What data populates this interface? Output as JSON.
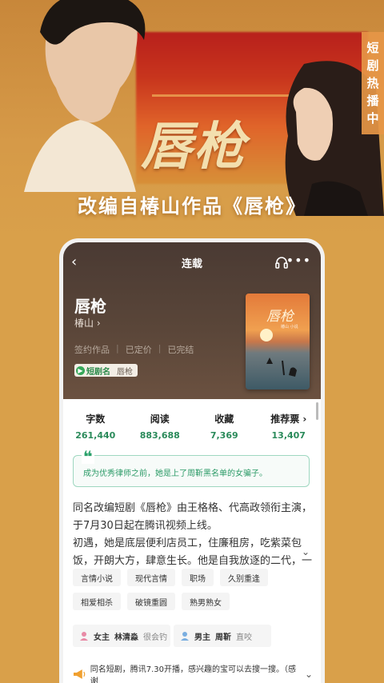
{
  "banner": {
    "poster_title": "唇枪",
    "caption": "改编自椿山作品《唇枪》",
    "side_tag": [
      "短",
      "剧",
      "热",
      "播",
      "中"
    ]
  },
  "topbar": {
    "title": "连载"
  },
  "book": {
    "title": "唇枪",
    "author": "椿山 ›",
    "meta": [
      "签约作品",
      "已定价",
      "已完结"
    ],
    "drama_badge": {
      "label": "短剧名",
      "name": "唇枪"
    },
    "cover_title": "唇枪",
    "cover_sub": "椿山 小说"
  },
  "stats": [
    {
      "label": "字数",
      "value": "261,440"
    },
    {
      "label": "阅读",
      "value": "883,688"
    },
    {
      "label": "收藏",
      "value": "7,369"
    },
    {
      "label": "推荐票 ›",
      "value": "13,407"
    }
  ],
  "quote": {
    "mark": "❝",
    "text": "成为优秀律师之前，她是上了周靳黑名单的女骗子。"
  },
  "description": {
    "line1": "同名改编短剧《唇枪》由王格格、代高政领衔主演，于7月30日起在腾讯视频上线。",
    "line2": "初遇，她是底层便利店员工，住廉租房，吃紫菜包饭，开朗大方，肆意生长。他是自我放逐的二代，一穷二…",
    "chevron": "⌄"
  },
  "tags": [
    "言情小说",
    "现代言情",
    "职场",
    "久别重逢",
    "相爱相杀",
    "破镜重圆",
    "熟男熟女"
  ],
  "roles": [
    {
      "label": "女主",
      "name": "林清淼",
      "trait": "很会钓",
      "color": "#e88aa6"
    },
    {
      "label": "男主",
      "name": "周靳",
      "trait": "直咬",
      "color": "#7aaee0"
    }
  ],
  "notice": {
    "text": "同名短剧，腾讯7.30开播，感兴趣的宝可以去搜一搜。（感谢",
    "chevron": "⌄"
  },
  "colors": {
    "page_bg": "#d9a04a",
    "accent_green": "#2a8a5a",
    "hero_bg": "#4a3a33"
  }
}
